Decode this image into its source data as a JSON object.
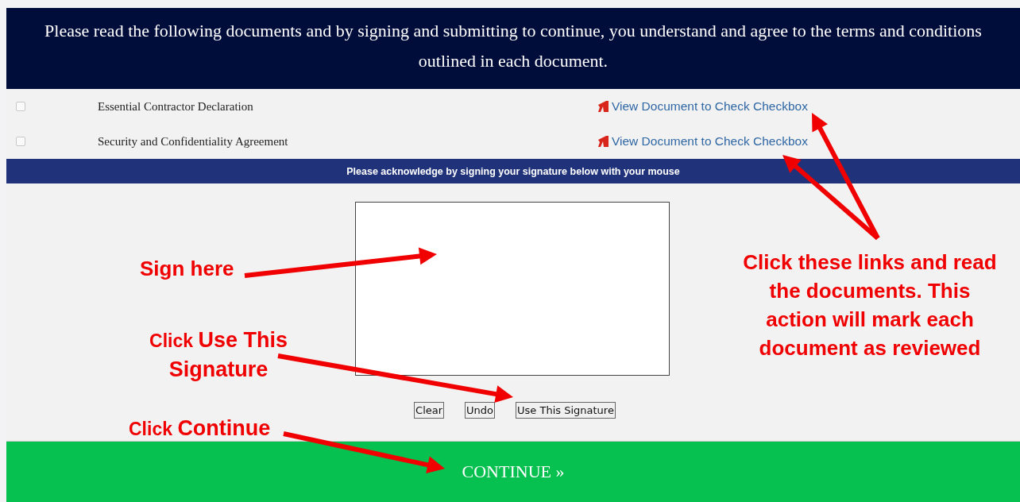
{
  "header": {
    "text": "Please read the following documents and by signing and submitting to continue, you understand and agree to the terms and conditions outlined in each document."
  },
  "documents": [
    {
      "name": "Essential Contractor Declaration",
      "checked": false,
      "link": "View Document to Check Checkbox"
    },
    {
      "name": "Security and Confidentiality Agreement",
      "checked": false,
      "link": "View Document to Check Checkbox"
    }
  ],
  "signature_bar": {
    "text": "Please acknowledge by signing your signature below with your mouse"
  },
  "signature_buttons": [
    "Clear",
    "Undo",
    "Use This Signature"
  ],
  "continue_button": "CONTINUE »",
  "annotations": [
    {
      "text": "Sign here"
    },
    {
      "text": "Click **Use This Signature**"
    },
    {
      "text": "Click **Continue**"
    },
    {
      "text": "Click these links and read the documents. This action will mark each document as reviewed"
    }
  ]
}
